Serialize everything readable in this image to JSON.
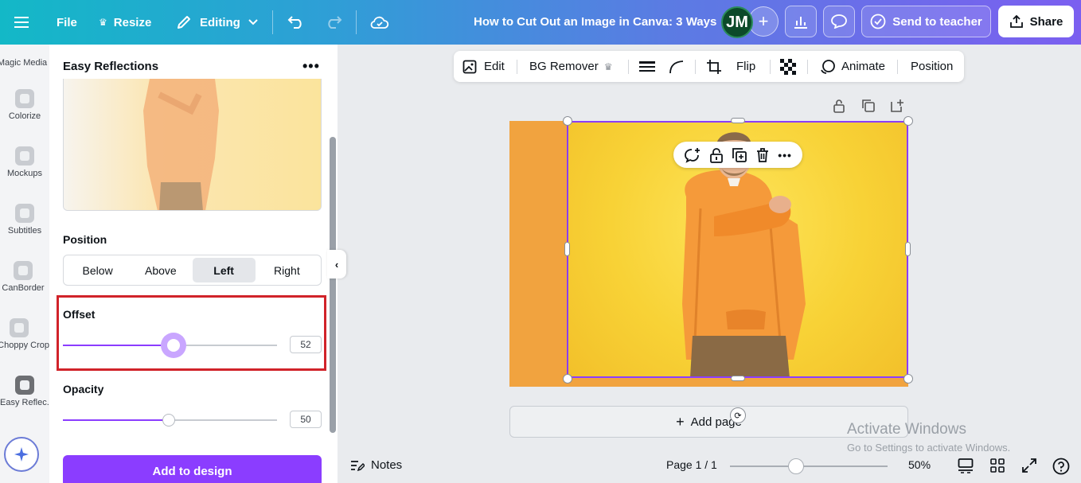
{
  "topbar": {
    "file_label": "File",
    "resize_label": "Resize",
    "editing_label": "Editing",
    "doc_title": "How to Cut Out an Image in Canva: 3 Ways",
    "avatar_initials": "JM",
    "send_label": "Send to teacher",
    "share_label": "Share"
  },
  "rail": {
    "items": [
      {
        "label": "Magic Media",
        "icon": "magic-media-icon"
      },
      {
        "label": "Colorize",
        "icon": "colorize-icon"
      },
      {
        "label": "Mockups",
        "icon": "mockups-icon"
      },
      {
        "label": "Subtitles",
        "icon": "subtitles-icon"
      },
      {
        "label": "CanBorder",
        "icon": "canborder-icon"
      },
      {
        "label": "Choppy Crop",
        "icon": "choppy-crop-icon"
      },
      {
        "label": "Easy Reflec...",
        "icon": "easy-reflections-icon"
      }
    ]
  },
  "panel": {
    "title": "Easy Reflections",
    "position_label": "Position",
    "position_options": [
      "Below",
      "Above",
      "Left",
      "Right"
    ],
    "position_selected": "Left",
    "offset_label": "Offset",
    "offset_value": "52",
    "opacity_label": "Opacity",
    "opacity_value": "50",
    "add_button": "Add to design"
  },
  "context_toolbar": {
    "edit": "Edit",
    "bg_remover": "BG Remover",
    "flip": "Flip",
    "animate": "Animate",
    "position": "Position"
  },
  "canvas": {
    "add_page": "Add page"
  },
  "watermark": {
    "line1": "Activate Windows",
    "line2": "Go to Settings to activate Windows."
  },
  "bottombar": {
    "notes": "Notes",
    "page_indicator": "Page 1 / 1",
    "zoom": "50%"
  },
  "colors": {
    "accent": "#8b3dff",
    "highlight_box": "#d1232a",
    "page_orange": "#f1a33f",
    "photo_yellow": "#f8d236"
  }
}
